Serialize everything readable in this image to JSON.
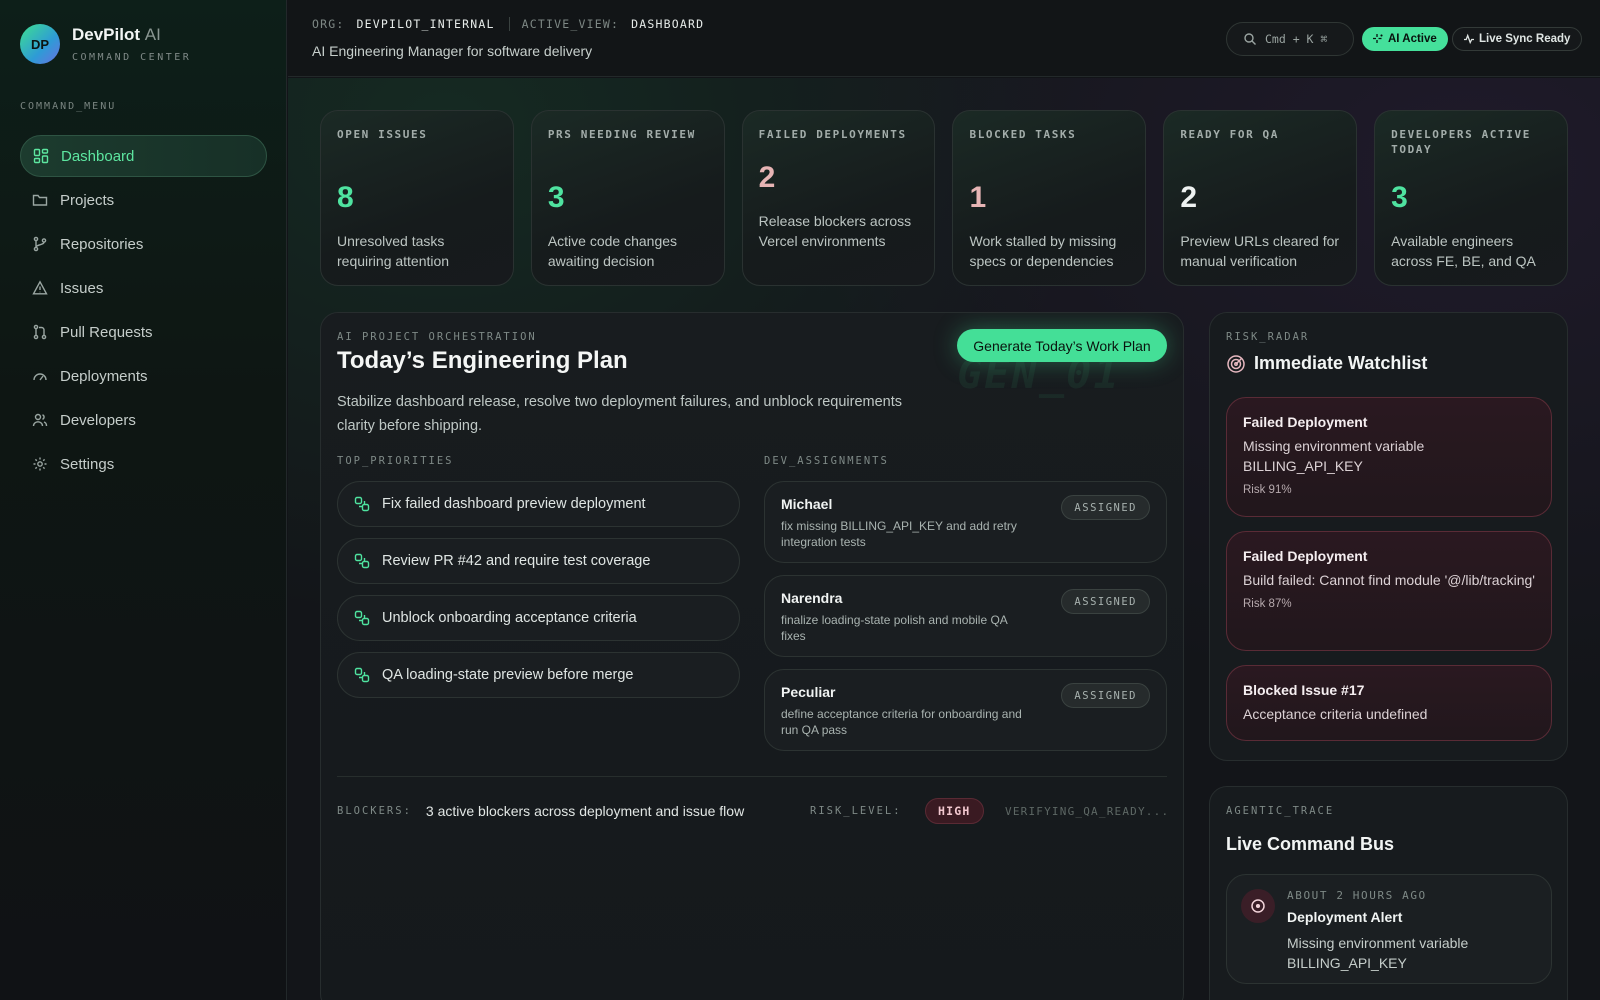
{
  "brand": {
    "initials": "DP",
    "name": "DevPilot",
    "suffix": "AI",
    "subtitle": "COMMAND CENTER"
  },
  "sidebar": {
    "menu_title": "COMMAND_MENU",
    "items": [
      {
        "label": "Dashboard",
        "icon": "dashboard-icon",
        "active": true
      },
      {
        "label": "Projects",
        "icon": "folder-icon"
      },
      {
        "label": "Repositories",
        "icon": "git-branch-icon"
      },
      {
        "label": "Issues",
        "icon": "warning-icon"
      },
      {
        "label": "Pull Requests",
        "icon": "pull-request-icon"
      },
      {
        "label": "Deployments",
        "icon": "gauge-icon"
      },
      {
        "label": "Developers",
        "icon": "users-icon"
      },
      {
        "label": "Settings",
        "icon": "gear-icon"
      }
    ]
  },
  "header": {
    "org_key": "ORG:",
    "org_value": "DEVPILOT_INTERNAL",
    "view_key": "ACTIVE_VIEW:",
    "view_value": "DASHBOARD",
    "tagline": "AI Engineering Manager for software delivery",
    "search_label": "Cmd + K ⌘",
    "ai_status": "AI Active",
    "sync_status": "Live Sync Ready"
  },
  "stats": [
    {
      "label": "OPEN ISSUES",
      "value": "8",
      "desc": "Unresolved tasks requiring attention"
    },
    {
      "label": "PRS NEEDING REVIEW",
      "value": "3",
      "desc": "Active code changes awaiting decision"
    },
    {
      "label": "FAILED DEPLOYMENTS",
      "value": "2",
      "desc": "Release blockers across Vercel environments"
    },
    {
      "label": "BLOCKED TASKS",
      "value": "1",
      "desc": "Work stalled by missing specs or dependencies"
    },
    {
      "label": "READY FOR QA",
      "value": "2",
      "desc": "Preview URLs cleared for manual verification"
    },
    {
      "label": "DEVELOPERS ACTIVE TODAY",
      "value": "3",
      "desc": "Available engineers across FE, BE, and QA"
    }
  ],
  "plan": {
    "eyebrow": "AI PROJECT ORCHESTRATION",
    "title": "Today’s Engineering Plan",
    "desc": "Stabilize dashboard release, resolve two deployment failures, and unblock requirements clarity before shipping.",
    "button": "Generate Today’s Work Plan",
    "watermark": "GEN_01",
    "priorities_label": "TOP_PRIORITIES",
    "priorities": [
      "Fix failed dashboard preview deployment",
      "Review PR #42 and require test coverage",
      "Unblock onboarding acceptance criteria",
      "QA loading-state preview before merge"
    ],
    "assignments_label": "DEV_ASSIGNMENTS",
    "assignments": [
      {
        "name": "Michael",
        "task": "fix missing BILLING_API_KEY and add retry integration tests",
        "status": "ASSIGNED"
      },
      {
        "name": "Narendra",
        "task": "finalize loading-state polish and mobile QA fixes",
        "status": "ASSIGNED"
      },
      {
        "name": "Peculiar",
        "task": "define acceptance criteria for onboarding and run QA pass",
        "status": "ASSIGNED"
      }
    ],
    "blockers_key": "BLOCKERS:",
    "blockers_value": "3 active blockers across deployment and issue flow",
    "risk_key": "RISK_LEVEL:",
    "risk_value": "HIGH",
    "verify_text": "VERIFYING_QA_READY..."
  },
  "radar": {
    "eyebrow": "RISK_RADAR",
    "title": "Immediate Watchlist",
    "items": [
      {
        "title": "Failed Deployment",
        "desc": "Missing environment variable BILLING_API_KEY",
        "risk": "Risk 91%"
      },
      {
        "title": "Failed Deployment",
        "desc": "Build failed: Cannot find module '@/lib/tracking'",
        "risk": "Risk 87%"
      },
      {
        "title": "Blocked Issue #17",
        "desc": "Acceptance criteria undefined"
      }
    ]
  },
  "bus": {
    "eyebrow": "AGENTIC_TRACE",
    "title": "Live Command Bus",
    "event": {
      "time": "ABOUT 2 HOURS AGO",
      "title": "Deployment Alert",
      "desc": "Missing environment variable BILLING_API_KEY",
      "icon": "alert-circle-icon"
    }
  },
  "colors": {
    "accent": "#45e09b",
    "danger": "#5a2b36",
    "background": "#121418"
  }
}
